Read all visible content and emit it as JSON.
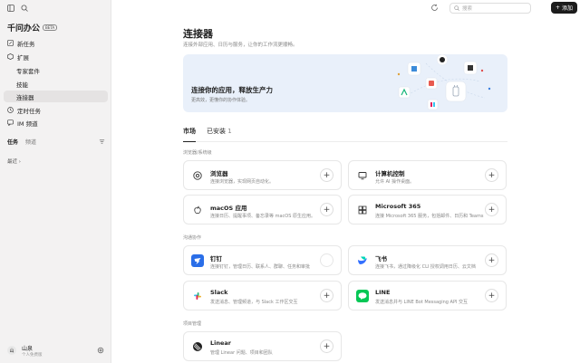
{
  "app": {
    "name": "千问办公",
    "badge": "BETA"
  },
  "sidebar": {
    "items": [
      {
        "label": "新任务",
        "icon": "edit-icon"
      },
      {
        "label": "扩展",
        "icon": "cube-icon"
      },
      {
        "label": "专家套件",
        "icon": ""
      },
      {
        "label": "技能",
        "icon": ""
      },
      {
        "label": "连接器",
        "icon": ""
      },
      {
        "label": "定时任务",
        "icon": "clock-icon"
      },
      {
        "label": "IM 频道",
        "icon": "chat-icon"
      }
    ],
    "tabs": [
      "任务",
      "频道"
    ],
    "recent": "最近"
  },
  "user": {
    "name": "山泉",
    "plan": "个人免费版",
    "avatar": "山"
  },
  "topbar": {
    "search_placeholder": "搜索",
    "add_label": "添加"
  },
  "page": {
    "title": "连接器",
    "subtitle": "连接外部应用、日历与服务，让你的工作流更顺畅。"
  },
  "banner": {
    "title": "连接你的应用，释放生产力",
    "subtitle": "更高效，更懂你的协作体验。"
  },
  "market_tabs": [
    {
      "label": "市场",
      "count": ""
    },
    {
      "label": "已安装",
      "count": "1"
    }
  ],
  "sections": [
    {
      "title": "浏览器/系统级",
      "cards": [
        {
          "title": "浏览器",
          "desc": "连接浏览器，实现网页自动化。",
          "icon": "chrome-icon",
          "toggle": "+"
        },
        {
          "title": "计算机控制",
          "desc": "允许 AI 操作桌面。",
          "icon": "monitor-icon",
          "toggle": "+"
        },
        {
          "title": "macOS 应用",
          "desc": "连接日历、提醒事项、备忘录等 macOS 原生应用。",
          "icon": "apple-icon",
          "toggle": "+"
        },
        {
          "title": "Microsoft 365",
          "desc": "连接 Microsoft 365 服务，包括邮件、日历和 Teams",
          "icon": "microsoft-icon",
          "toggle": "+"
        }
      ]
    },
    {
      "title": "沟通协作",
      "cards": [
        {
          "title": "钉钉",
          "desc": "连接钉钉，管理日历、联系人、群聊、任务和审批",
          "icon": "dingtalk-icon",
          "toggle": ""
        },
        {
          "title": "飞书",
          "desc": "连接飞书，通过降级化 CLI 授权调用日历、云文档",
          "icon": "feishu-icon",
          "toggle": "+"
        },
        {
          "title": "Slack",
          "desc": "发送消息、管理频道，与 Slack 工作区交互",
          "icon": "slack-icon",
          "toggle": "+"
        },
        {
          "title": "LINE",
          "desc": "发送消息并与 LINE Bot Messaging API 交互",
          "icon": "line-icon",
          "toggle": "+"
        }
      ]
    },
    {
      "title": "项目管理",
      "cards": [
        {
          "title": "Linear",
          "desc": "管理 Linear 问题、项目和团队",
          "icon": "linear-icon",
          "toggle": "+"
        }
      ]
    }
  ]
}
